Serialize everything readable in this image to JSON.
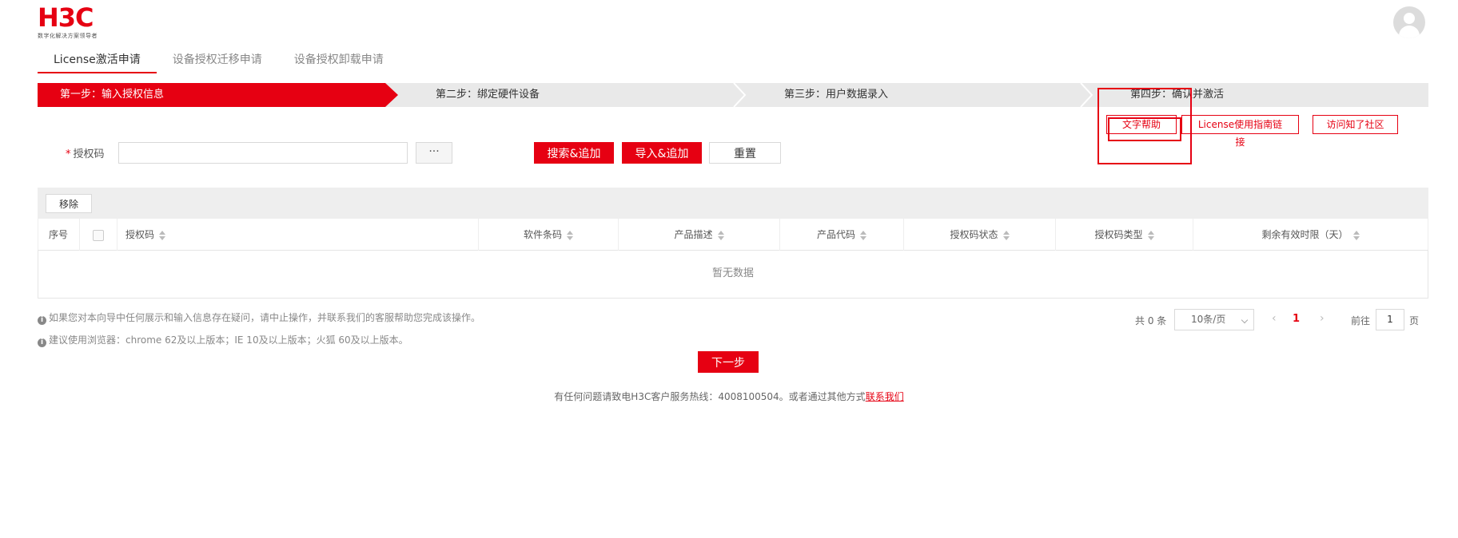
{
  "logo": {
    "mark": "H3C",
    "tagline": "数字化解决方案领导者"
  },
  "tabs": [
    {
      "label": "License激活申请",
      "active": true
    },
    {
      "label": "设备授权迁移申请",
      "active": false
    },
    {
      "label": "设备授权卸载申请",
      "active": false
    }
  ],
  "steps": [
    {
      "label": "第一步：输入授权信息",
      "active": true
    },
    {
      "label": "第二步：绑定硬件设备",
      "active": false
    },
    {
      "label": "第三步：用户数据录入",
      "active": false
    },
    {
      "label": "第四步：确认并激活",
      "active": false
    }
  ],
  "help_buttons": {
    "text_help": "文字帮助",
    "license_guide": "License使用指南链接",
    "community": "访问知了社区"
  },
  "form": {
    "required_mark": "*",
    "license_label": "授权码",
    "license_value": "",
    "more_label": "···",
    "search_add": "搜索&追加",
    "import_add": "导入&追加",
    "reset": "重置"
  },
  "table": {
    "remove_label": "移除",
    "columns": [
      "序号",
      "授权码",
      "软件条码",
      "产品描述",
      "产品代码",
      "授权码状态",
      "授权码类型",
      "剩余有效时限（天）"
    ],
    "empty_text": "暂无数据"
  },
  "tips": [
    "如果您对本向导中任何展示和输入信息存在疑问，请中止操作，并联系我们的客服帮助您完成该操作。",
    "建议使用浏览器：chrome 62及以上版本；IE 10及以上版本；火狐 60及以上版本。"
  ],
  "pagination": {
    "total_text": "共 0 条",
    "page_size": "10条/页",
    "current_page": "1",
    "goto_label": "前往",
    "goto_value": "1",
    "page_unit": "页"
  },
  "next_label": "下一步",
  "footer": {
    "text": "有任何问题请致电H3C客户服务热线：4008100504。或者通过其他方式",
    "link": "联系我们"
  },
  "colors": {
    "brand": "#e60012",
    "step_bg": "#e9e9e9"
  }
}
